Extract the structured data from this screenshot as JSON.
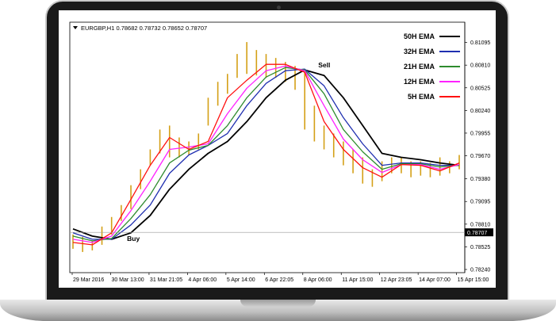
{
  "chart_window": {
    "symbol_title": "EURGBP,H1  0.78682 0.78732 0.78652 0.78707",
    "title_arrow_icon": "triangle-down-icon"
  },
  "colors": {
    "ema50": "#000000",
    "ema32": "#1f2fb0",
    "ema21": "#2e8b2e",
    "ema12": "#ff22ff",
    "ema5": "#ff1010",
    "candle_bull": "#d4a017",
    "candle_bear": "#d4a017",
    "current_price_box": "#000000",
    "frame": "#1a1a1a"
  },
  "chart_data": {
    "type": "line",
    "title": "EURGBP,H1  0.78682 0.78732 0.78652 0.78707",
    "x_tick_labels": [
      "29 Mar 2016",
      "30 Mar 13:00",
      "31 Mar 21:05",
      "4 Apr 06:00",
      "5 Apr 14:00",
      "6 Apr 22:05",
      "8 Apr 06:00",
      "11 Apr 15:00",
      "12 Apr 23:05",
      "14 Apr 07:00",
      "15 Apr 15:00"
    ],
    "y_ticks": [
      0.81095,
      0.8081,
      0.80525,
      0.8024,
      0.79955,
      0.7967,
      0.7938,
      0.79095,
      0.7881,
      0.78525,
      0.7824
    ],
    "y_tick_labels": [
      "0.81095",
      "0.80810",
      "0.80525",
      "0.80240",
      "0.79955",
      "0.79670",
      "0.79380",
      "0.79095",
      "0.78810",
      "0.78525",
      "0.78240"
    ],
    "ylim": [
      0.782,
      0.8135
    ],
    "xlim": [
      0,
      100
    ],
    "current_price": 0.78707,
    "current_price_label": "0.78707",
    "legend_placement": "top-right",
    "grid": false,
    "series": [
      {
        "name": "50H EMA",
        "color": "#000000",
        "x": [
          0,
          5,
          10,
          15,
          20,
          25,
          30,
          35,
          40,
          45,
          50,
          55,
          60,
          65,
          70,
          75,
          80,
          85,
          90,
          95,
          100
        ],
        "y": [
          0.7875,
          0.7866,
          0.7862,
          0.787,
          0.7892,
          0.7925,
          0.795,
          0.797,
          0.7985,
          0.801,
          0.804,
          0.8062,
          0.8075,
          0.8068,
          0.804,
          0.8005,
          0.797,
          0.7965,
          0.7962,
          0.7958,
          0.7955
        ]
      },
      {
        "name": "32H EMA",
        "color": "#1f2fb0",
        "x": [
          0,
          5,
          10,
          15,
          20,
          25,
          30,
          35,
          40,
          45,
          50,
          55,
          60,
          65,
          70,
          75,
          80,
          85,
          90,
          95,
          100
        ],
        "y": [
          0.787,
          0.7862,
          0.7862,
          0.788,
          0.7905,
          0.7945,
          0.7968,
          0.798,
          0.7995,
          0.803,
          0.8058,
          0.8074,
          0.8076,
          0.8055,
          0.8015,
          0.7982,
          0.7955,
          0.7958,
          0.7958,
          0.7955,
          0.7955
        ]
      },
      {
        "name": "21H EMA",
        "color": "#2e8b2e",
        "x": [
          0,
          5,
          10,
          15,
          20,
          25,
          30,
          35,
          40,
          45,
          50,
          55,
          60,
          65,
          70,
          75,
          80,
          85,
          90,
          95,
          100
        ],
        "y": [
          0.7866,
          0.786,
          0.7863,
          0.7888,
          0.7918,
          0.7958,
          0.7974,
          0.798,
          0.8005,
          0.804,
          0.8066,
          0.8078,
          0.8075,
          0.8045,
          0.8,
          0.7972,
          0.795,
          0.7957,
          0.7957,
          0.7953,
          0.7955
        ]
      },
      {
        "name": "12H EMA",
        "color": "#ff22ff",
        "x": [
          0,
          5,
          10,
          15,
          20,
          25,
          30,
          35,
          40,
          45,
          50,
          55,
          60,
          65,
          70,
          75,
          80,
          85,
          90,
          95,
          100
        ],
        "y": [
          0.7862,
          0.7858,
          0.7866,
          0.7898,
          0.7935,
          0.7975,
          0.7978,
          0.7982,
          0.802,
          0.8052,
          0.8074,
          0.808,
          0.8074,
          0.803,
          0.7988,
          0.7962,
          0.7946,
          0.7956,
          0.7956,
          0.795,
          0.7956
        ]
      },
      {
        "name": "5H EMA",
        "color": "#ff1010",
        "x": [
          0,
          5,
          10,
          15,
          20,
          25,
          30,
          35,
          40,
          45,
          50,
          55,
          60,
          65,
          70,
          75,
          80,
          85,
          90,
          95,
          100
        ],
        "y": [
          0.7858,
          0.7855,
          0.787,
          0.7912,
          0.7955,
          0.799,
          0.7975,
          0.7985,
          0.804,
          0.8062,
          0.8082,
          0.8082,
          0.8072,
          0.801,
          0.7975,
          0.7952,
          0.794,
          0.7956,
          0.7955,
          0.7948,
          0.7958
        ]
      }
    ],
    "price_candles": {
      "x": [
        0,
        2.5,
        5,
        7.5,
        10,
        12.5,
        15,
        17.5,
        20,
        22.5,
        25,
        27.5,
        30,
        32.5,
        35,
        37.5,
        40,
        42.5,
        45,
        47.5,
        50,
        52.5,
        55,
        57.5,
        60,
        62.5,
        65,
        67.5,
        70,
        72.5,
        75,
        77.5,
        80,
        82.5,
        85,
        87.5,
        90,
        92.5,
        95,
        97.5,
        100
      ],
      "high": [
        0.7868,
        0.7865,
        0.786,
        0.7878,
        0.789,
        0.7905,
        0.793,
        0.795,
        0.7975,
        0.8,
        0.8005,
        0.799,
        0.7985,
        0.7995,
        0.804,
        0.806,
        0.807,
        0.8095,
        0.811,
        0.81,
        0.8095,
        0.809,
        0.8085,
        0.808,
        0.8075,
        0.803,
        0.8005,
        0.7995,
        0.7985,
        0.7975,
        0.7965,
        0.795,
        0.796,
        0.7965,
        0.7965,
        0.796,
        0.796,
        0.7958,
        0.7965,
        0.796,
        0.7968
      ],
      "low": [
        0.785,
        0.7846,
        0.7848,
        0.7855,
        0.7868,
        0.7885,
        0.79,
        0.7925,
        0.7955,
        0.797,
        0.7965,
        0.7965,
        0.7968,
        0.7975,
        0.8005,
        0.803,
        0.8045,
        0.8065,
        0.807,
        0.8068,
        0.8065,
        0.8065,
        0.806,
        0.805,
        0.8,
        0.7985,
        0.7975,
        0.7965,
        0.7955,
        0.7945,
        0.7932,
        0.7928,
        0.7935,
        0.7945,
        0.7945,
        0.794,
        0.7942,
        0.794,
        0.7942,
        0.7945,
        0.795
      ]
    },
    "annotations": [
      {
        "text": "Buy",
        "x": 14,
        "y": 0.786
      },
      {
        "text": "Sell",
        "x": 63.5,
        "y": 0.8078
      }
    ]
  }
}
